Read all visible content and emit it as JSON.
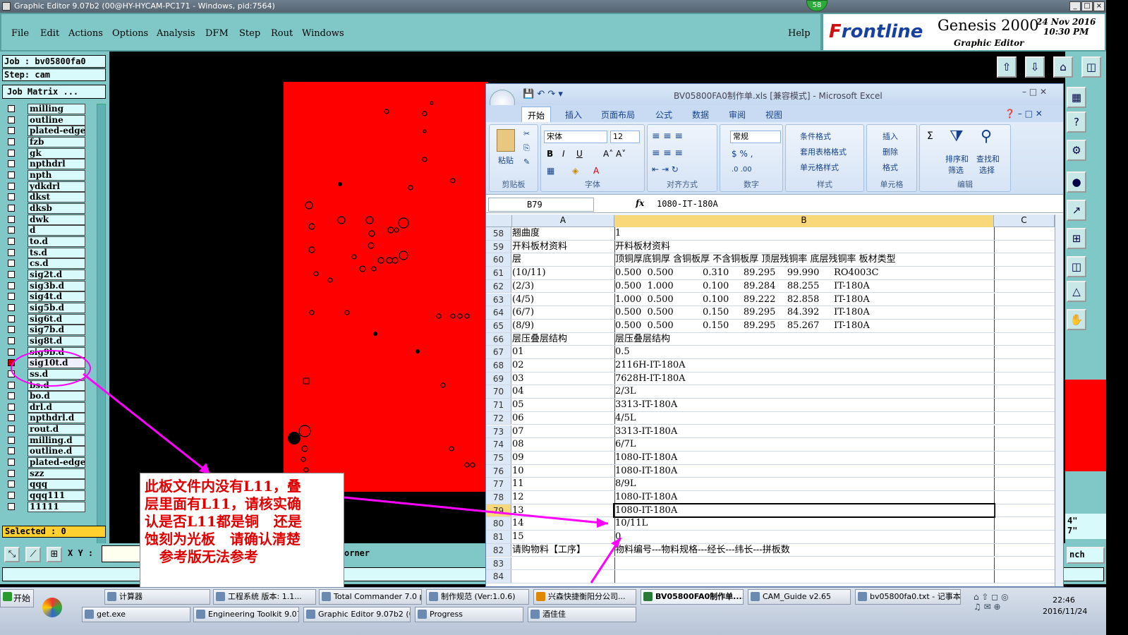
{
  "app": {
    "title": "Graphic Editor 9.07b2 (00@HY-HYCAM-PC171 - Windows, pid:7564)",
    "badge": "58",
    "menu": [
      "File",
      "Edit",
      "Actions",
      "Options",
      "Analysis",
      "DFM",
      "Step",
      "Rout",
      "Windows"
    ],
    "help": "Help",
    "brand": {
      "frontline_a": "F",
      "frontline_b": "rontline",
      "product": "Genesis 2000",
      "subtitle": "Graphic Editor",
      "date": "24 Nov 2016",
      "time": "10:30 PM"
    }
  },
  "job": {
    "job_label": "Job : bv05800fa0",
    "step_label": "Step: cam",
    "matrix_button": "Job Matrix ...",
    "selected": "Selected : 0"
  },
  "layers": [
    "milling",
    "outline",
    "plated-edge",
    "fzb",
    "gk",
    "npthdrl",
    "npth",
    "ydkdrl",
    "dkst",
    "dksb",
    "dwk",
    "d",
    "to.d",
    "ts.d",
    "cs.d",
    "sig2t.d",
    "sig3b.d",
    "sig4t.d",
    "sig5b.d",
    "sig6t.d",
    "sig7b.d",
    "sig8t.d",
    "sig9b.d",
    "sig10t.d",
    "ss.d",
    "bs.d",
    "bo.d",
    "drl.d",
    "npthdrl.d",
    "rout.d",
    "milling.d",
    "outline.d",
    "plated-edge",
    "szz",
    "qqq",
    "qqq111",
    "11111"
  ],
  "bottom": {
    "xy_label": "X Y :",
    "corner_label": "orner",
    "right_a": "4\"",
    "right_b": "7\"",
    "branch": "nch"
  },
  "excel": {
    "title": "BV05800FA0制作单.xls  [兼容模式] - Microsoft Excel",
    "tabs": [
      "开始",
      "插入",
      "页面布局",
      "公式",
      "数据",
      "审阅",
      "视图"
    ],
    "ribbon": {
      "paste": "粘贴",
      "clipboard": "剪贴板",
      "font_name": "宋体",
      "font_size": "12",
      "font_group": "字体",
      "align_group": "对齐方式",
      "number_format": "常规",
      "number_group": "数字",
      "cond_format": "条件格式",
      "table_format": "套用表格格式",
      "cell_style": "单元格样式",
      "style_group": "样式",
      "insert": "插入",
      "delete": "删除",
      "format": "格式",
      "cells_group": "单元格",
      "sort_a": "排序和",
      "sort_b": "筛选",
      "find_a": "查找和",
      "find_b": "选择",
      "edit_group": "编辑"
    },
    "name_box": "B79",
    "fx": "fx",
    "formula": "1080-IT-180A",
    "columns": [
      "A",
      "B",
      "C"
    ],
    "rows": [
      {
        "n": "58",
        "a": "翘曲度",
        "b": "1"
      },
      {
        "n": "59",
        "a": "开料板材资料",
        "b": "开料板材资料"
      },
      {
        "n": "60",
        "a": "层",
        "b": "顶铜厚底铜厚 含铜板厚 不含铜板厚 顶层残铜率 底层残铜率 板材类型"
      },
      {
        "n": "61",
        "a": "(10/11)",
        "b": "0.500  0.500          0.310     89.295    99.990     RO4003C"
      },
      {
        "n": "62",
        "a": "(2/3)",
        "b": "0.500  1.000          0.100     89.284    88.255     IT-180A"
      },
      {
        "n": "63",
        "a": "(4/5)",
        "b": "1.000  0.500          0.100     89.222    82.858     IT-180A"
      },
      {
        "n": "64",
        "a": "(6/7)",
        "b": "0.500  0.500          0.150     89.295    84.392     IT-180A"
      },
      {
        "n": "65",
        "a": "(8/9)",
        "b": "0.500  0.500          0.150     89.295    85.267     IT-180A"
      },
      {
        "n": "66",
        "a": "层压叠层结构",
        "b": "层压叠层结构"
      },
      {
        "n": "67",
        "a": "01",
        "b": "0.5"
      },
      {
        "n": "68",
        "a": "02",
        "b": "2116H-IT-180A"
      },
      {
        "n": "69",
        "a": "03",
        "b": "7628H-IT-180A"
      },
      {
        "n": "70",
        "a": "04",
        "b": "2/3L"
      },
      {
        "n": "71",
        "a": "05",
        "b": "3313-IT-180A"
      },
      {
        "n": "72",
        "a": "06",
        "b": "4/5L"
      },
      {
        "n": "73",
        "a": "07",
        "b": "3313-IT-180A"
      },
      {
        "n": "74",
        "a": "08",
        "b": "6/7L"
      },
      {
        "n": "75",
        "a": "09",
        "b": "1080-IT-180A"
      },
      {
        "n": "76",
        "a": "10",
        "b": "1080-IT-180A"
      },
      {
        "n": "77",
        "a": "11",
        "b": "8/9L"
      },
      {
        "n": "78",
        "a": "12",
        "b": "1080-IT-180A"
      },
      {
        "n": "79",
        "a": "13",
        "b": "1080-IT-180A"
      },
      {
        "n": "80",
        "a": "14",
        "b": "10/11L"
      },
      {
        "n": "81",
        "a": "15",
        "b": "0"
      },
      {
        "n": "82",
        "a": "请购物料【工序】",
        "b": "物料编号---物料规格---经长---纬长---拼板数"
      },
      {
        "n": "83",
        "a": "",
        "b": ""
      },
      {
        "n": "84",
        "a": "",
        "b": ""
      }
    ]
  },
  "annotation": {
    "lines": [
      "此板文件内没有L11，叠",
      "层里面有L11，请核实确",
      "认是否L11都是铜   还是",
      "蚀刻为光板   请确认清楚",
      "   参考版无法参考"
    ]
  },
  "taskbar": {
    "start": "开始",
    "row1": [
      "计算器",
      "工程系统  版本: 1.1...",
      "Total Commander 7.0 p...",
      "制作规范 (Ver:1.0.6)",
      "兴森快捷衡阳分公司...",
      "BV05800FA0制作单....",
      "CAM_Guide v2.65",
      "bv05800fa0.txt - 记事本"
    ],
    "row2": [
      "get.exe",
      "Engineering Toolkit 9.07...",
      "Graphic Editor 9.07b2 (0...",
      "Progress",
      "酒佳佳"
    ],
    "time": "22:46",
    "date": "2016/11/24"
  },
  "colors": {
    "accent_teal": "#80c8c8",
    "board_red": "#ff0000",
    "annotation_red": "#e00000",
    "magenta_arrow": "#ff00ff"
  }
}
